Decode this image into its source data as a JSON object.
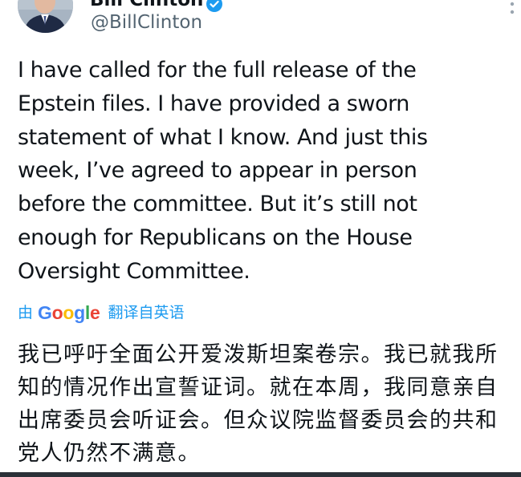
{
  "author": {
    "display_name": "Bill Clinton",
    "handle": "@BillClinton"
  },
  "icons": {
    "avatar": "avatar-photo",
    "verified": "verified-badge-icon",
    "more": "more-options-icon"
  },
  "tweet": {
    "text": "I have called for the full release of the\nEpstein files. I have provided a sworn\nstatement of what I know. And just this\nweek, I’ve agreed to appear in person\nbefore the committee. But it’s still not\nenough for Republicans on the House\nOversight Committee."
  },
  "translation": {
    "by_label": "由",
    "provider": "Google",
    "label": "翻译自英语",
    "text": "我已呼吁全面公开爱泼斯坦案卷宗。我已就我所知的情况作出宣誓证词。就在本周，我同意亲自出席委员会听证会。但众议院监督委员会的共和党人仍然不满意。"
  },
  "colors": {
    "text_primary": "#0f1419",
    "text_secondary": "#536471",
    "accent": "#1d9bf0",
    "google_blue": "#4285f4",
    "google_red": "#ea4335",
    "google_yellow": "#fbbc05",
    "google_green": "#34a853"
  }
}
